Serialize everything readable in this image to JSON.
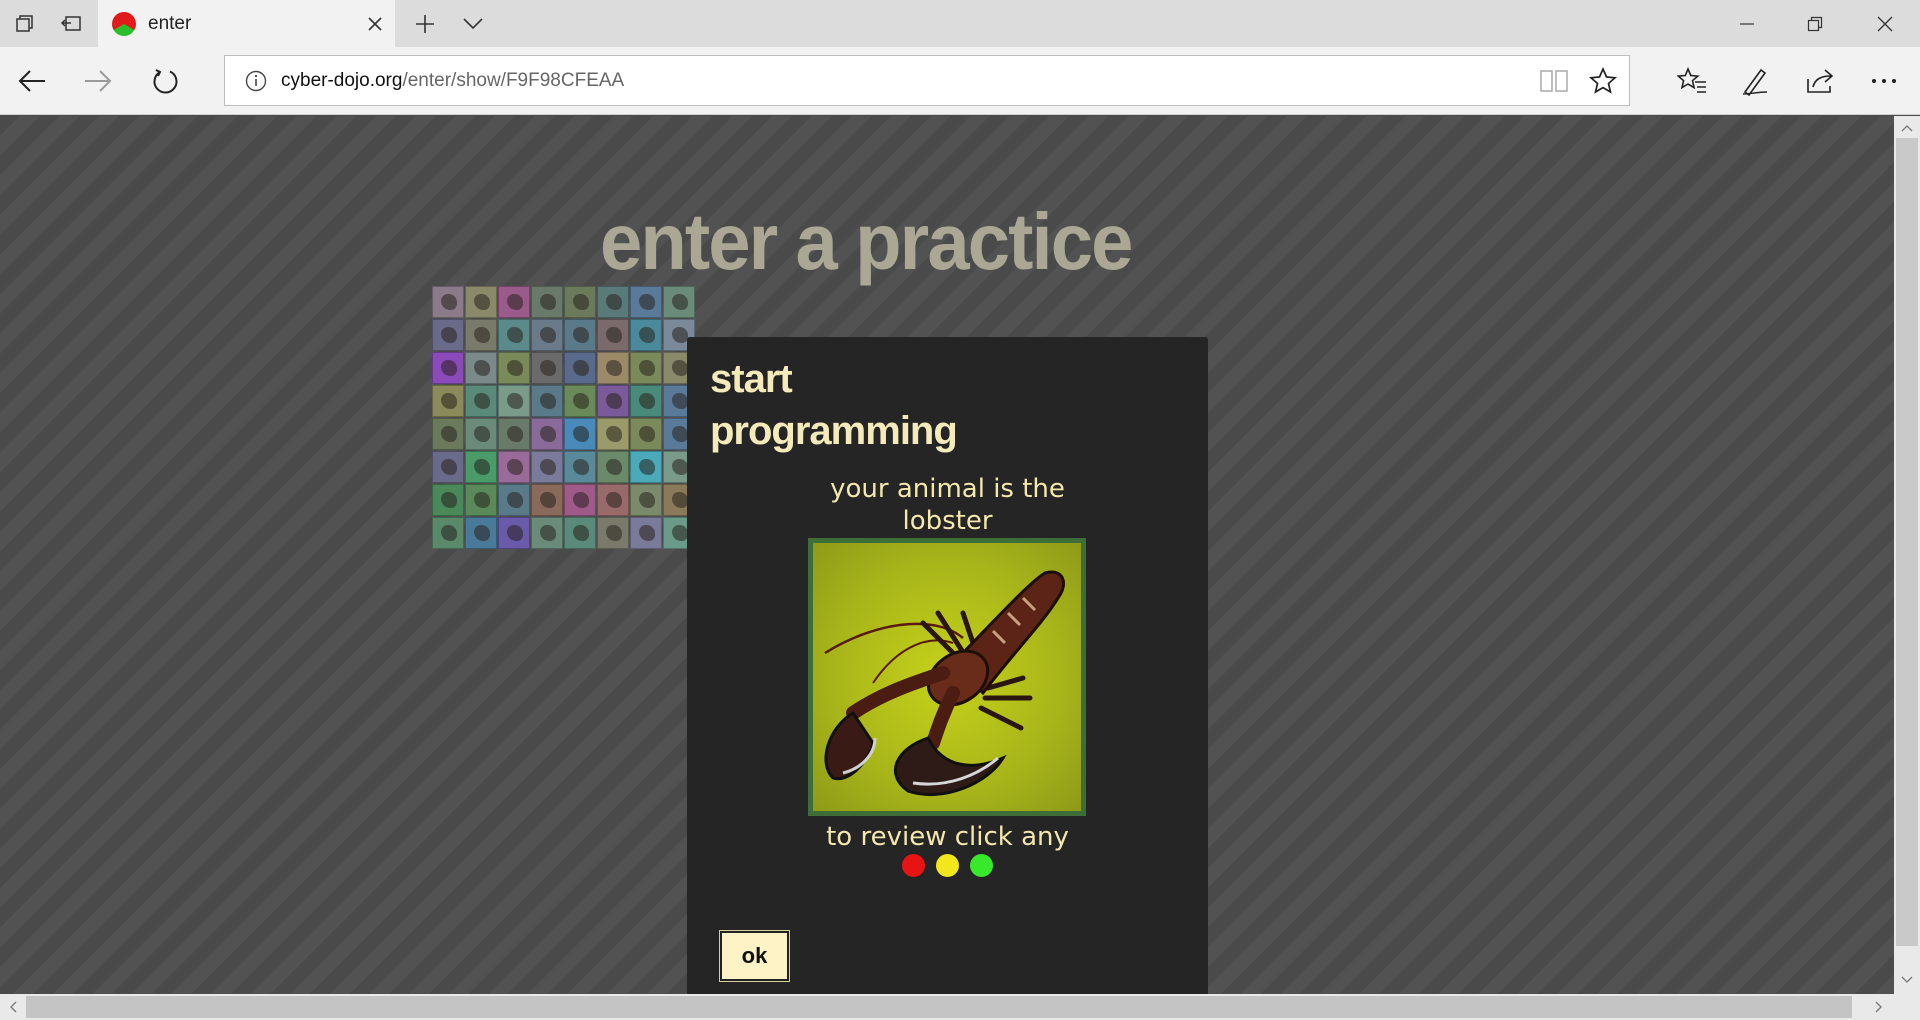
{
  "tab": {
    "title": "enter",
    "icon": "cyber-dojo-favicon"
  },
  "address_bar": {
    "host": "cyber-dojo.org",
    "path": "/enter/show/F9F98CFEAA"
  },
  "toolbar_icons": [
    "back-icon",
    "forward-icon",
    "refresh-icon",
    "info-icon",
    "reading-view-icon",
    "favorite-star-icon",
    "favorites-hub-icon",
    "web-note-icon",
    "share-icon",
    "more-icon"
  ],
  "page": {
    "heading": "enter a practice"
  },
  "modal": {
    "title_line1": "start",
    "title_line2": "programming",
    "animal_line1": "your animal is the",
    "animal_line2": "lobster",
    "review_text": "to review click any",
    "ok_label": "ok",
    "light_colors": [
      "#e81414",
      "#f2e61c",
      "#38e82a"
    ]
  },
  "colors": {
    "modal_bg": "#252525",
    "modal_text": "#f4e8ad",
    "page_bg": "#4a4a4a"
  },
  "avatar_tile_colors": [
    "#8a7a8a",
    "#8a8a6a",
    "#9a5a8a",
    "#6a7a6a",
    "#6a7a5a",
    "#5a7a7a",
    "#5a7a9a",
    "#6a8a7a",
    "#6a6a8a",
    "#7a7a6a",
    "#5a8a8a",
    "#6a7a8a",
    "#5a7a8a",
    "#7a6a6a",
    "#4a8a9a",
    "#7a8a9a",
    "#8a4aba",
    "#7a8a8a",
    "#7a8a5a",
    "#6a6a6a",
    "#5a6a8a",
    "#9a8a6a",
    "#7a8a5a",
    "#8a8a6a",
    "#8a8a5a",
    "#5a8a7a",
    "#7a9a8a",
    "#5a7a8a",
    "#6a8a5a",
    "#7a5a9a",
    "#4a8a7a",
    "#5a7a9a",
    "#6a7a5a",
    "#6a8a7a",
    "#6a7a6a",
    "#8a6a9a",
    "#4a8aba",
    "#9a9a6a",
    "#7a8a5a",
    "#5a7a9a",
    "#6a6a8a",
    "#4a9a6a",
    "#9a6a9a",
    "#7a7a9a",
    "#5a8a9a",
    "#6a8a6a",
    "#4aaaba",
    "#7a9a8a",
    "#4a8a5a",
    "#5a8a5a",
    "#5a7a8a",
    "#8a6a5a",
    "#a05a8a",
    "#9a6a6a",
    "#7a8a6a",
    "#8a7a5a",
    "#5a8a6a",
    "#4a7a9a",
    "#6a5aaa",
    "#6a8a7a",
    "#5a8a7a",
    "#7a7a6a",
    "#7a7a9a",
    "#6a9a8a"
  ]
}
